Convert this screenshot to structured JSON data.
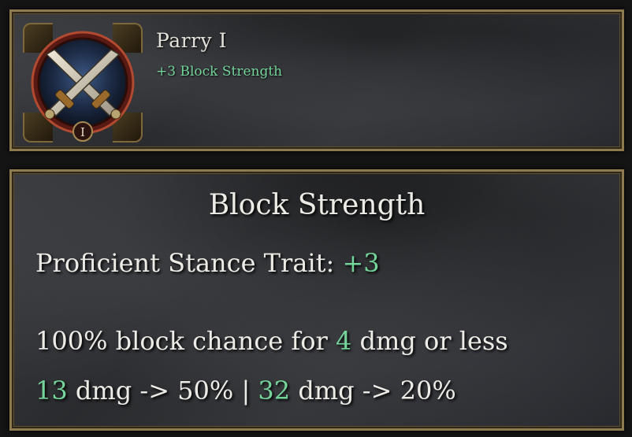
{
  "skill": {
    "name": "Parry I",
    "bonus": "+3 Block Strength",
    "icon": "crossed-swords-icon",
    "rank_numeral": "I"
  },
  "tooltip": {
    "heading": "Block Strength",
    "trait_label": "Proficient Stance Trait:",
    "trait_value": "+3",
    "block_prefix": "100% block chance for",
    "block_threshold": "4",
    "block_suffix": "dmg or less",
    "tier1_damage": "13",
    "tier1_text": "dmg -> 50%",
    "separator": "|",
    "tier2_damage": "32",
    "tier2_text": "dmg -> 20%"
  },
  "colors": {
    "highlight_green": "#74d49a",
    "frame_gold": "#8d7a4e",
    "text_light": "#ecebe6"
  }
}
